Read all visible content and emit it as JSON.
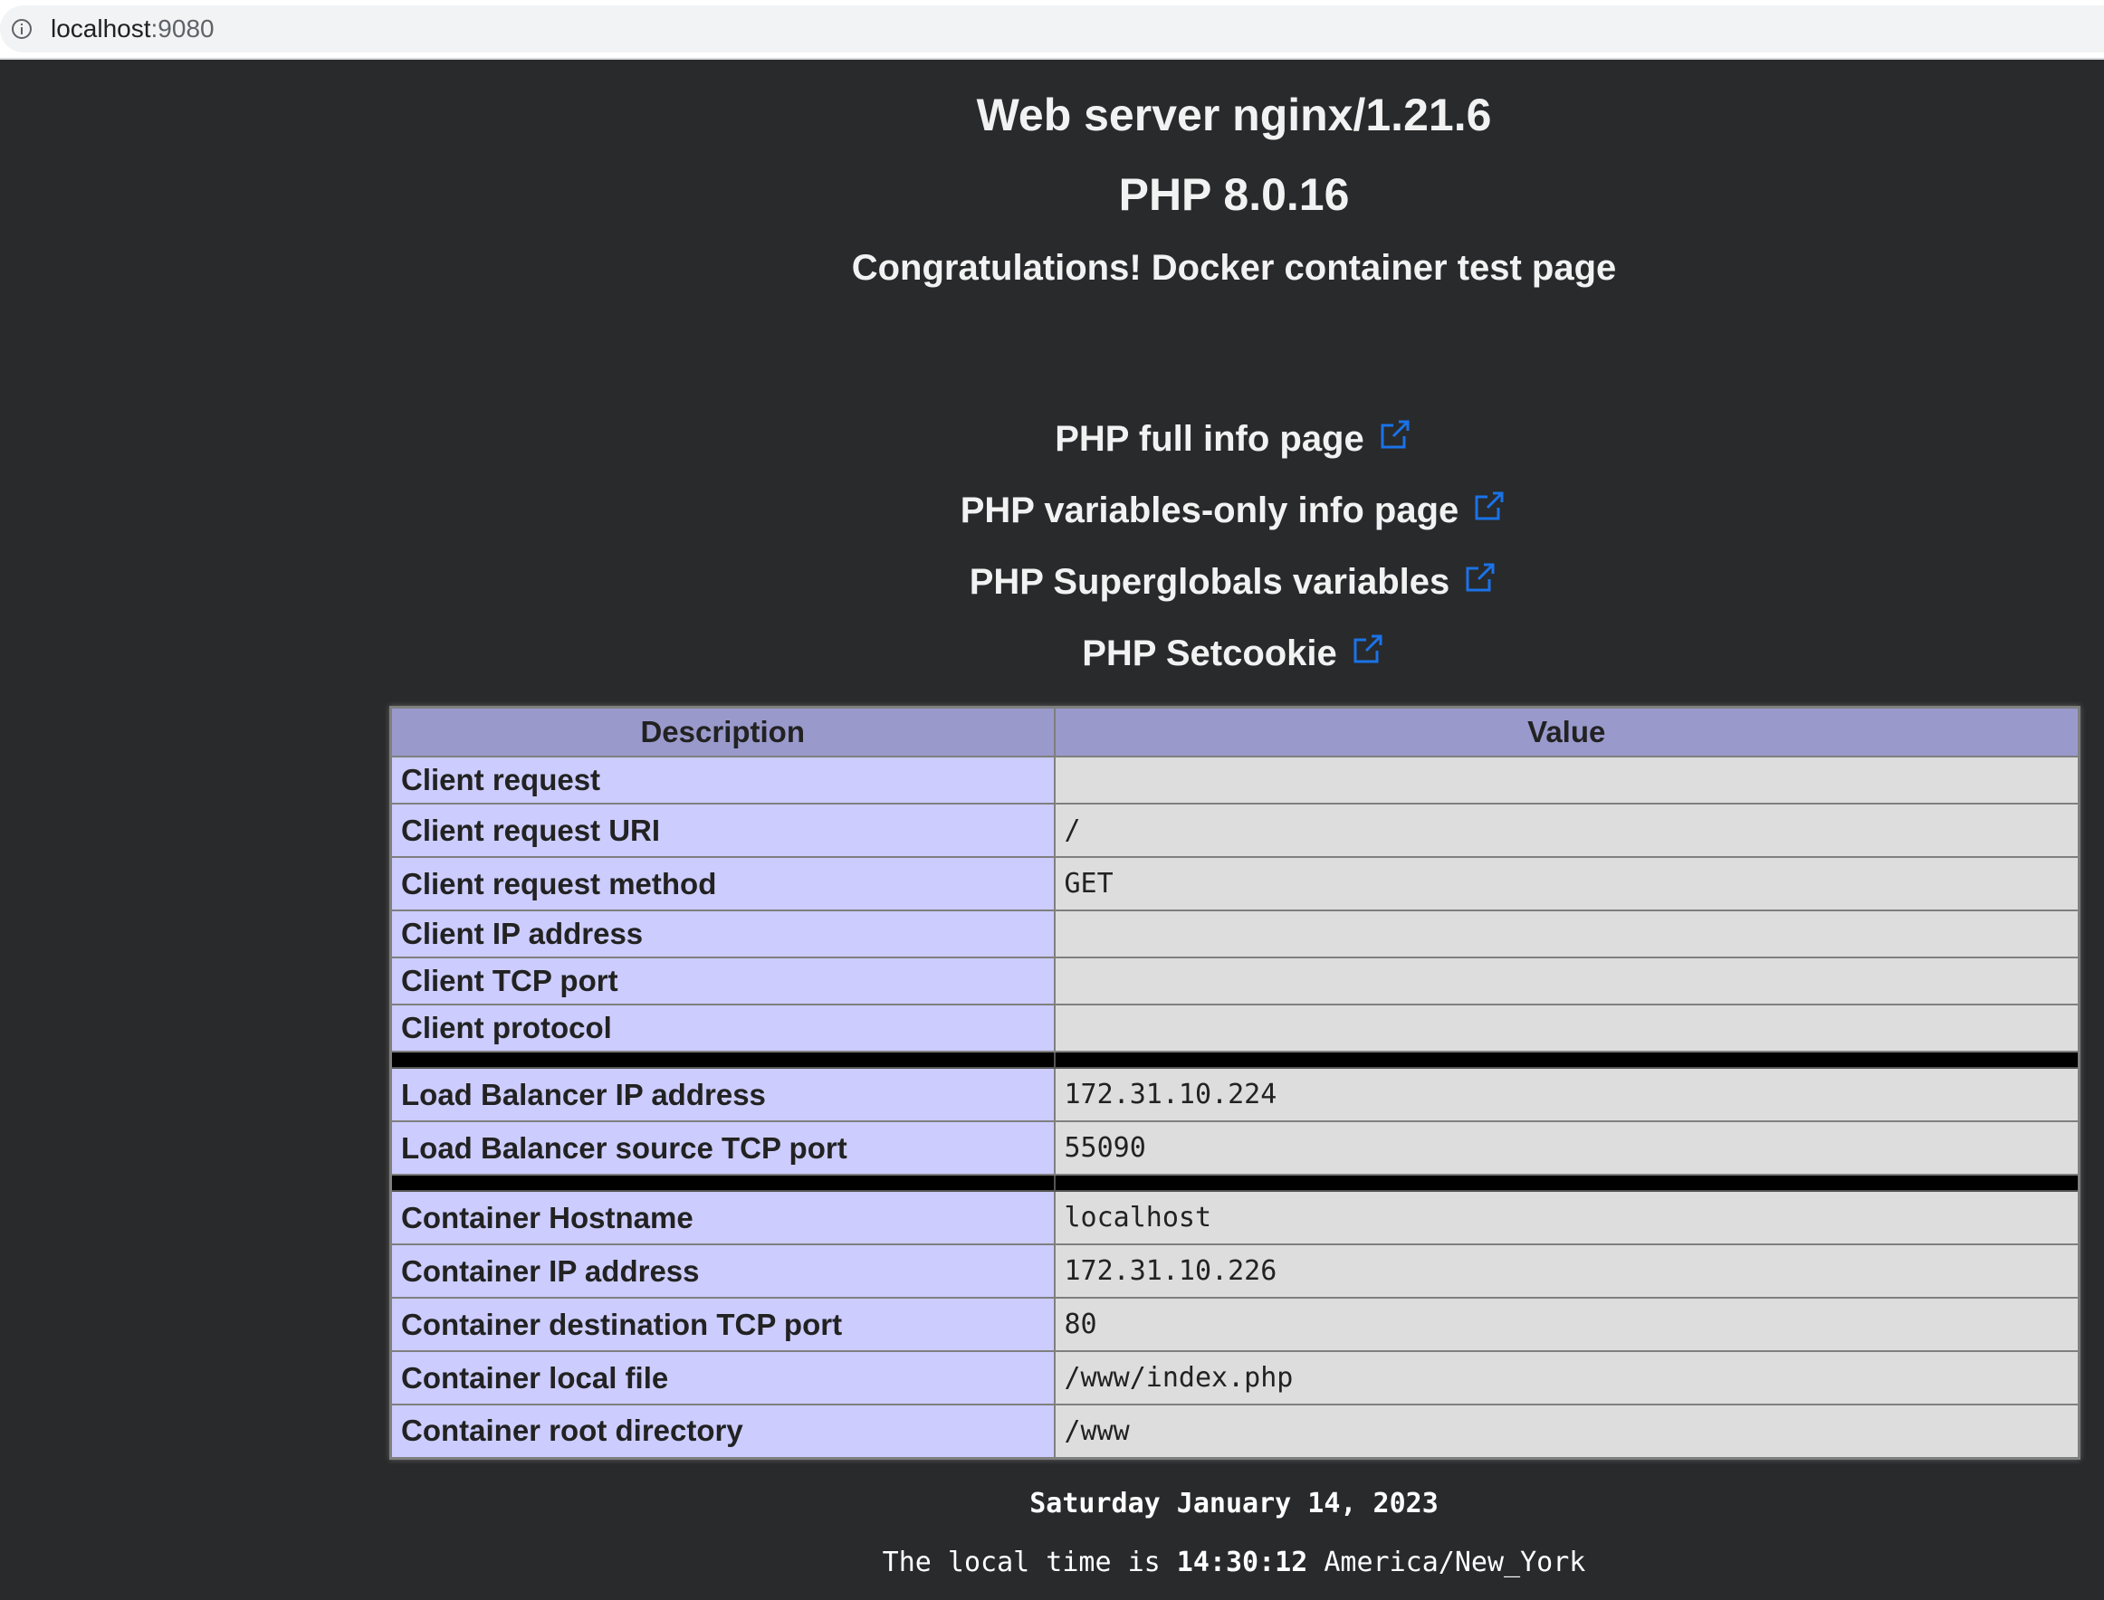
{
  "browser": {
    "url_host": "localhost",
    "url_port": ":9080",
    "info_icon": "info-icon"
  },
  "headings": {
    "server": "Web server nginx/1.21.6",
    "php": "PHP 8.0.16",
    "congrats": "Congratulations! Docker container test page"
  },
  "links": [
    {
      "label": "PHP full info page",
      "icon": "external-link-icon"
    },
    {
      "label": "PHP variables-only info page",
      "icon": "external-link-icon"
    },
    {
      "label": "PHP Superglobals variables",
      "icon": "external-link-icon"
    },
    {
      "label": "PHP Setcookie",
      "icon": "external-link-icon"
    }
  ],
  "table": {
    "headers": {
      "description": "Description",
      "value": "Value"
    },
    "rows": [
      {
        "desc": "Client request",
        "value": ""
      },
      {
        "desc": "Client request URI",
        "value": "/"
      },
      {
        "desc": "Client request method",
        "value": "GET"
      },
      {
        "desc": "Client IP address",
        "value": ""
      },
      {
        "desc": "Client TCP port",
        "value": ""
      },
      {
        "desc": "Client protocol",
        "value": ""
      },
      {
        "desc": "Load Balancer IP address",
        "value": "172.31.10.224"
      },
      {
        "desc": "Load Balancer source TCP port",
        "value": "55090"
      },
      {
        "desc": "Container Hostname",
        "value": "localhost"
      },
      {
        "desc": "Container IP address",
        "value": "172.31.10.226"
      },
      {
        "desc": "Container destination TCP port",
        "value": "80"
      },
      {
        "desc": "Container local file",
        "value": "/www/index.php"
      },
      {
        "desc": "Container root directory",
        "value": "/www"
      }
    ]
  },
  "footer": {
    "date": "Saturday January 14, 2023",
    "time_prefix": "The local time is",
    "time_value": "14:30:12",
    "timezone": "America/New_York"
  },
  "colors": {
    "page_bg": "#292a2b",
    "link_icon": "#1a73e8",
    "header_bg": "#9999cc",
    "desc_bg": "#ccccff",
    "value_bg": "#dddddd"
  }
}
